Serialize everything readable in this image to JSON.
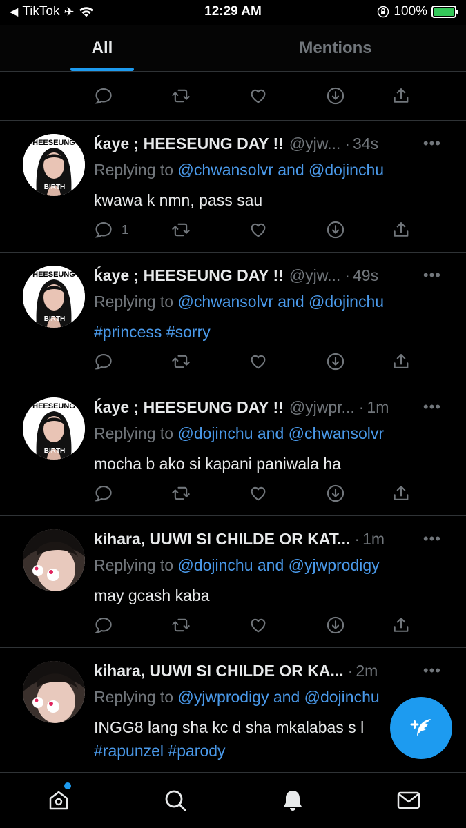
{
  "status_bar": {
    "carrier": "TikTok",
    "time": "12:29 AM",
    "battery": "100%"
  },
  "tabs": [
    {
      "label": "All",
      "active": true
    },
    {
      "label": "Mentions",
      "active": false
    }
  ],
  "colors": {
    "accent": "#1d9bf0",
    "link": "#4a99e9",
    "muted": "#71767b",
    "background": "#000000"
  },
  "tweets": [
    {
      "name": "ḱaye ; HEESEUNG DAY !!",
      "handle": "@yjw...",
      "time": "34s",
      "reply_prefix": "Replying to",
      "mentions": "@chwansolvr and @dojinchu",
      "body": "kwawa k nmn, pass sau",
      "body_is_link": false,
      "reply_count": "1"
    },
    {
      "name": "ḱaye ; HEESEUNG DAY !!",
      "handle": "@yjw...",
      "time": "49s",
      "reply_prefix": "Replying to",
      "mentions": "@chwansolvr and @dojinchu",
      "body": "#princess #sorry",
      "body_is_link": true,
      "reply_count": ""
    },
    {
      "name": "ḱaye ; HEESEUNG DAY !!",
      "handle": "@yjwpr...",
      "time": "1m",
      "reply_prefix": "Replying to",
      "mentions": "@dojinchu and @chwansolvr",
      "body": "mocha b ako si kapani paniwala ha",
      "body_is_link": false,
      "reply_count": ""
    },
    {
      "name": "kihara, UUWI SI CHILDE OR KAT...",
      "handle": "",
      "time": "1m",
      "reply_prefix": "Replying to",
      "mentions": "@dojinchu and @yjwprodigy",
      "body": "may gcash kaba",
      "body_is_link": false,
      "reply_count": ""
    },
    {
      "name": "kihara, UUWI SI CHILDE OR KA...",
      "handle": "",
      "time": "2m",
      "reply_prefix": "Replying to",
      "mentions": "@yjwprodigy and @dojinchu",
      "body": "INGG8 lang sha kc d sha mkalabas s l",
      "body2": "#rapunzel #parody",
      "body_is_link": false,
      "reply_count": ""
    }
  ],
  "avatar_text": {
    "top": "HEESEUNG",
    "bottom": "BIRTH"
  },
  "icons": {
    "reply": "reply-icon",
    "retweet": "retweet-icon",
    "like": "heart-icon",
    "download": "download-icon",
    "share": "share-icon",
    "compose": "compose-icon",
    "home": "home-icon",
    "search": "search-icon",
    "notifications": "bell-icon",
    "messages": "mail-icon"
  }
}
